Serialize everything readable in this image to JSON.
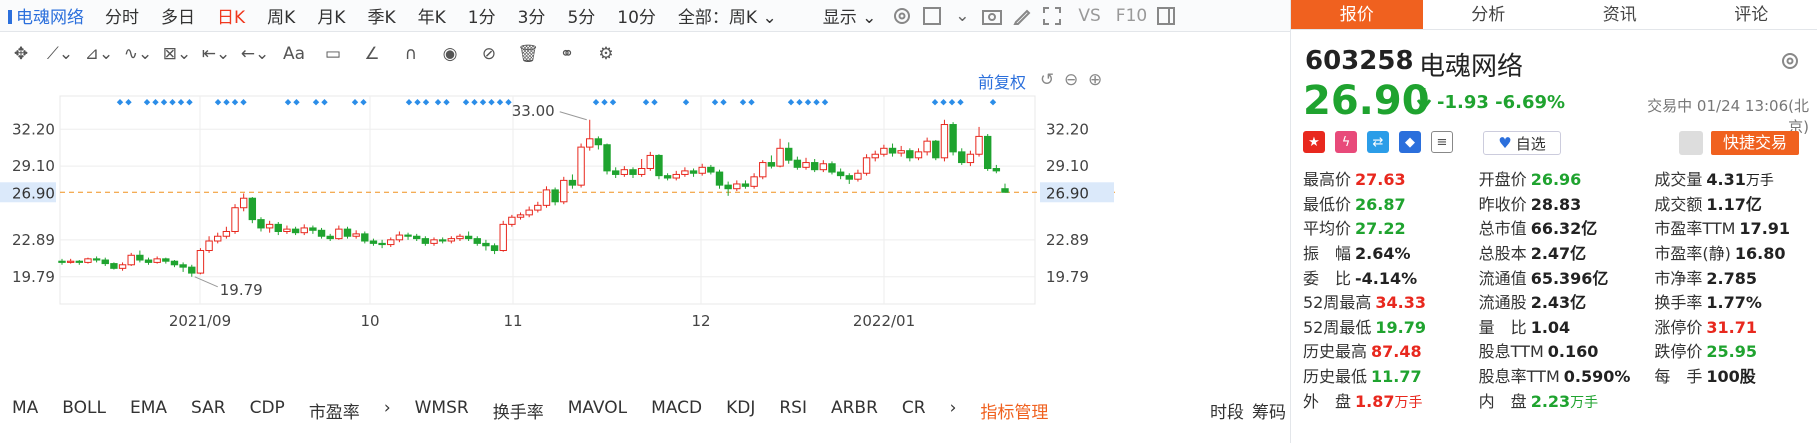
{
  "toolbar": {
    "stock_name": "电魂网络",
    "periods": [
      "分时",
      "多日",
      "日K",
      "周K",
      "月K",
      "季K",
      "年K",
      "1分",
      "3分",
      "5分",
      "10分"
    ],
    "active_period": "日K",
    "scope": "全部：周K",
    "display": "显示",
    "vs": "VS",
    "f10": "F10"
  },
  "adjust": "前复权",
  "chart_data": {
    "type": "candlestick",
    "title": "",
    "y_ticks": [
      32.2,
      29.1,
      26.9,
      22.89,
      19.79
    ],
    "ylim": [
      17.5,
      35.0
    ],
    "x_ticks": [
      "2021/09",
      "10",
      "11",
      "12",
      "2022/01"
    ],
    "last_price": 26.9,
    "annotations": [
      {
        "label": "33.00"
      },
      {
        "label": "19.79"
      }
    ],
    "candles": [
      {
        "o": 21.1,
        "c": 21.0,
        "h": 21.3,
        "l": 20.8
      },
      {
        "o": 21.0,
        "c": 21.1,
        "h": 21.3,
        "l": 20.9
      },
      {
        "o": 21.1,
        "c": 21.0,
        "h": 21.2,
        "l": 20.8
      },
      {
        "o": 21.0,
        "c": 21.3,
        "h": 21.4,
        "l": 20.9
      },
      {
        "o": 21.3,
        "c": 21.2,
        "h": 21.5,
        "l": 21.0
      },
      {
        "o": 21.2,
        "c": 20.9,
        "h": 21.4,
        "l": 20.7
      },
      {
        "o": 20.9,
        "c": 20.5,
        "h": 21.0,
        "l": 20.4
      },
      {
        "o": 20.5,
        "c": 20.8,
        "h": 21.0,
        "l": 20.3
      },
      {
        "o": 20.8,
        "c": 21.6,
        "h": 21.8,
        "l": 20.7
      },
      {
        "o": 21.6,
        "c": 21.2,
        "h": 22.0,
        "l": 21.0
      },
      {
        "o": 21.2,
        "c": 21.0,
        "h": 21.4,
        "l": 20.8
      },
      {
        "o": 21.0,
        "c": 21.3,
        "h": 21.5,
        "l": 20.9
      },
      {
        "o": 21.3,
        "c": 21.1,
        "h": 21.4,
        "l": 20.9
      },
      {
        "o": 21.1,
        "c": 20.8,
        "h": 21.2,
        "l": 20.6
      },
      {
        "o": 20.8,
        "c": 20.6,
        "h": 21.0,
        "l": 20.2
      },
      {
        "o": 20.6,
        "c": 20.1,
        "h": 20.8,
        "l": 19.79
      },
      {
        "o": 20.1,
        "c": 22.0,
        "h": 22.2,
        "l": 20.0
      },
      {
        "o": 22.0,
        "c": 22.8,
        "h": 23.2,
        "l": 21.8
      },
      {
        "o": 22.8,
        "c": 23.2,
        "h": 23.5,
        "l": 22.6
      },
      {
        "o": 23.2,
        "c": 23.6,
        "h": 24.0,
        "l": 23.0
      },
      {
        "o": 23.6,
        "c": 25.6,
        "h": 25.9,
        "l": 23.4
      },
      {
        "o": 25.6,
        "c": 26.4,
        "h": 26.8,
        "l": 25.3
      },
      {
        "o": 26.4,
        "c": 24.6,
        "h": 26.5,
        "l": 24.3
      },
      {
        "o": 24.6,
        "c": 23.9,
        "h": 24.8,
        "l": 23.6
      },
      {
        "o": 23.9,
        "c": 24.2,
        "h": 24.5,
        "l": 23.5
      },
      {
        "o": 24.2,
        "c": 23.6,
        "h": 24.4,
        "l": 23.3
      },
      {
        "o": 23.6,
        "c": 23.8,
        "h": 24.1,
        "l": 23.4
      },
      {
        "o": 23.8,
        "c": 23.5,
        "h": 24.0,
        "l": 23.3
      },
      {
        "o": 23.5,
        "c": 23.9,
        "h": 24.2,
        "l": 23.3
      },
      {
        "o": 23.9,
        "c": 23.7,
        "h": 24.1,
        "l": 23.4
      },
      {
        "o": 23.7,
        "c": 23.2,
        "h": 23.9,
        "l": 23.0
      },
      {
        "o": 23.2,
        "c": 23.0,
        "h": 23.4,
        "l": 22.8
      },
      {
        "o": 23.0,
        "c": 23.8,
        "h": 24.1,
        "l": 22.9
      },
      {
        "o": 23.8,
        "c": 23.2,
        "h": 24.0,
        "l": 23.0
      },
      {
        "o": 23.2,
        "c": 23.4,
        "h": 23.7,
        "l": 23.0
      },
      {
        "o": 23.4,
        "c": 22.8,
        "h": 23.6,
        "l": 22.6
      },
      {
        "o": 22.8,
        "c": 22.6,
        "h": 23.0,
        "l": 22.4
      },
      {
        "o": 22.6,
        "c": 22.5,
        "h": 22.9,
        "l": 22.2
      },
      {
        "o": 22.5,
        "c": 22.9,
        "h": 23.1,
        "l": 22.3
      },
      {
        "o": 22.9,
        "c": 23.3,
        "h": 23.6,
        "l": 22.7
      },
      {
        "o": 23.3,
        "c": 23.2,
        "h": 23.5,
        "l": 22.9
      },
      {
        "o": 23.2,
        "c": 23.0,
        "h": 23.4,
        "l": 22.8
      },
      {
        "o": 23.0,
        "c": 22.6,
        "h": 23.2,
        "l": 22.4
      },
      {
        "o": 22.6,
        "c": 22.9,
        "h": 23.1,
        "l": 22.4
      },
      {
        "o": 22.9,
        "c": 22.8,
        "h": 23.1,
        "l": 22.6
      },
      {
        "o": 22.8,
        "c": 23.0,
        "h": 23.2,
        "l": 22.6
      },
      {
        "o": 23.0,
        "c": 23.2,
        "h": 23.4,
        "l": 22.8
      },
      {
        "o": 23.2,
        "c": 23.0,
        "h": 23.6,
        "l": 22.8
      },
      {
        "o": 23.0,
        "c": 22.6,
        "h": 23.2,
        "l": 22.4
      },
      {
        "o": 22.6,
        "c": 22.4,
        "h": 22.9,
        "l": 22.0
      },
      {
        "o": 22.4,
        "c": 22.0,
        "h": 22.6,
        "l": 21.7
      },
      {
        "o": 22.0,
        "c": 24.2,
        "h": 24.5,
        "l": 21.9
      },
      {
        "o": 24.2,
        "c": 24.8,
        "h": 25.0,
        "l": 24.0
      },
      {
        "o": 24.8,
        "c": 25.0,
        "h": 25.2,
        "l": 24.6
      },
      {
        "o": 25.0,
        "c": 25.4,
        "h": 25.7,
        "l": 24.8
      },
      {
        "o": 25.4,
        "c": 25.8,
        "h": 26.1,
        "l": 25.2
      },
      {
        "o": 25.8,
        "c": 27.1,
        "h": 27.4,
        "l": 25.6
      },
      {
        "o": 27.1,
        "c": 26.1,
        "h": 27.3,
        "l": 25.8
      },
      {
        "o": 26.1,
        "c": 27.9,
        "h": 28.2,
        "l": 25.9
      },
      {
        "o": 27.9,
        "c": 27.5,
        "h": 28.4,
        "l": 27.2
      },
      {
        "o": 27.5,
        "c": 30.7,
        "h": 31.0,
        "l": 27.3
      },
      {
        "o": 30.7,
        "c": 31.4,
        "h": 33.0,
        "l": 30.4
      },
      {
        "o": 31.4,
        "c": 30.9,
        "h": 31.6,
        "l": 30.5
      },
      {
        "o": 30.9,
        "c": 28.7,
        "h": 31.0,
        "l": 28.4
      },
      {
        "o": 28.7,
        "c": 28.4,
        "h": 29.0,
        "l": 28.1
      },
      {
        "o": 28.4,
        "c": 28.8,
        "h": 29.1,
        "l": 28.2
      },
      {
        "o": 28.8,
        "c": 28.4,
        "h": 29.0,
        "l": 28.1
      },
      {
        "o": 28.4,
        "c": 28.9,
        "h": 29.7,
        "l": 28.2
      },
      {
        "o": 28.9,
        "c": 30.0,
        "h": 30.3,
        "l": 28.7
      },
      {
        "o": 30.0,
        "c": 28.3,
        "h": 30.1,
        "l": 28.0
      },
      {
        "o": 28.3,
        "c": 28.1,
        "h": 28.5,
        "l": 27.9
      },
      {
        "o": 28.1,
        "c": 28.4,
        "h": 28.7,
        "l": 27.9
      },
      {
        "o": 28.4,
        "c": 28.7,
        "h": 29.0,
        "l": 28.2
      },
      {
        "o": 28.7,
        "c": 28.5,
        "h": 28.9,
        "l": 28.2
      },
      {
        "o": 28.5,
        "c": 29.0,
        "h": 29.3,
        "l": 28.3
      },
      {
        "o": 29.0,
        "c": 28.6,
        "h": 29.2,
        "l": 28.4
      },
      {
        "o": 28.6,
        "c": 27.5,
        "h": 28.8,
        "l": 27.2
      },
      {
        "o": 27.5,
        "c": 27.2,
        "h": 27.8,
        "l": 26.6
      },
      {
        "o": 27.2,
        "c": 27.6,
        "h": 27.9,
        "l": 27.0
      },
      {
        "o": 27.6,
        "c": 27.4,
        "h": 27.9,
        "l": 27.2
      },
      {
        "o": 27.4,
        "c": 28.2,
        "h": 28.5,
        "l": 27.2
      },
      {
        "o": 28.2,
        "c": 29.4,
        "h": 29.6,
        "l": 28.0
      },
      {
        "o": 29.4,
        "c": 29.1,
        "h": 30.0,
        "l": 28.9
      },
      {
        "o": 29.1,
        "c": 30.6,
        "h": 31.4,
        "l": 29.0
      },
      {
        "o": 30.6,
        "c": 29.6,
        "h": 31.1,
        "l": 29.3
      },
      {
        "o": 29.6,
        "c": 29.0,
        "h": 29.9,
        "l": 28.8
      },
      {
        "o": 29.0,
        "c": 29.4,
        "h": 29.8,
        "l": 28.8
      },
      {
        "o": 29.4,
        "c": 28.8,
        "h": 29.7,
        "l": 28.6
      },
      {
        "o": 28.8,
        "c": 29.3,
        "h": 29.6,
        "l": 28.6
      },
      {
        "o": 29.3,
        "c": 28.6,
        "h": 29.5,
        "l": 28.4
      },
      {
        "o": 28.6,
        "c": 28.3,
        "h": 28.9,
        "l": 28.0
      },
      {
        "o": 28.3,
        "c": 28.0,
        "h": 28.5,
        "l": 27.6
      },
      {
        "o": 28.0,
        "c": 28.5,
        "h": 28.8,
        "l": 27.8
      },
      {
        "o": 28.5,
        "c": 29.8,
        "h": 30.1,
        "l": 28.3
      },
      {
        "o": 29.8,
        "c": 30.1,
        "h": 30.4,
        "l": 29.5
      },
      {
        "o": 30.1,
        "c": 30.6,
        "h": 30.9,
        "l": 29.9
      },
      {
        "o": 30.6,
        "c": 30.2,
        "h": 31.0,
        "l": 29.9
      },
      {
        "o": 30.2,
        "c": 30.4,
        "h": 30.8,
        "l": 29.9
      },
      {
        "o": 30.4,
        "c": 29.8,
        "h": 30.6,
        "l": 29.5
      },
      {
        "o": 29.8,
        "c": 30.3,
        "h": 30.6,
        "l": 29.6
      },
      {
        "o": 30.3,
        "c": 31.2,
        "h": 31.5,
        "l": 30.0
      },
      {
        "o": 31.2,
        "c": 29.8,
        "h": 31.3,
        "l": 29.6
      },
      {
        "o": 29.8,
        "c": 32.6,
        "h": 33.0,
        "l": 29.5
      },
      {
        "o": 32.6,
        "c": 30.3,
        "h": 32.8,
        "l": 30.0
      },
      {
        "o": 30.3,
        "c": 29.4,
        "h": 30.6,
        "l": 29.2
      },
      {
        "o": 29.4,
        "c": 30.1,
        "h": 30.4,
        "l": 29.1
      },
      {
        "o": 30.1,
        "c": 31.6,
        "h": 32.4,
        "l": 29.9
      },
      {
        "o": 31.6,
        "c": 28.9,
        "h": 31.8,
        "l": 28.7
      },
      {
        "o": 28.9,
        "c": 28.7,
        "h": 29.2,
        "l": 28.5
      },
      {
        "o": 27.2,
        "c": 26.9,
        "h": 27.63,
        "l": 26.87
      }
    ]
  },
  "quote": {
    "code": "603258",
    "name": "电魂网络",
    "price": "26.90",
    "change": "-1.93",
    "change_pct": "-6.69%",
    "status": "交易中 01/24 13:06(北京)",
    "fav": "自选",
    "quick_trade": "快捷交易"
  },
  "tabs": [
    "报价",
    "分析",
    "资讯",
    "评论"
  ],
  "stats": [
    [
      {
        "k": "最高价",
        "v": "27.63",
        "c": "red"
      },
      {
        "k": "开盘价",
        "v": "26.96",
        "c": "green"
      },
      {
        "k": "成交量",
        "v": "4.31",
        "u": "万手",
        "c": "dark"
      }
    ],
    [
      {
        "k": "最低价",
        "v": "26.87",
        "c": "green"
      },
      {
        "k": "昨收价",
        "v": "28.83",
        "c": "dark"
      },
      {
        "k": "成交额",
        "v": "1.17亿",
        "c": "dark"
      }
    ],
    [
      {
        "k": "平均价",
        "v": "27.22",
        "c": "green"
      },
      {
        "k": "总市值",
        "v": "66.32亿",
        "c": "dark"
      },
      {
        "k": "市盈率TTM",
        "v": "17.91",
        "c": "dark"
      }
    ],
    [
      {
        "k": "振　幅",
        "v": "2.64%",
        "c": "dark"
      },
      {
        "k": "总股本",
        "v": "2.47亿",
        "c": "dark"
      },
      {
        "k": "市盈率(静)",
        "v": "16.80",
        "c": "dark"
      }
    ],
    [
      {
        "k": "委　比",
        "v": "-4.14%",
        "c": "dark"
      },
      {
        "k": "流通值",
        "v": "65.396亿",
        "c": "dark"
      },
      {
        "k": "市净率",
        "v": "2.785",
        "c": "dark"
      }
    ],
    [
      {
        "k": "52周最高",
        "v": "34.33",
        "c": "red"
      },
      {
        "k": "流通股",
        "v": "2.43亿",
        "c": "dark"
      },
      {
        "k": "换手率",
        "v": "1.77%",
        "c": "dark"
      }
    ],
    [
      {
        "k": "52周最低",
        "v": "19.79",
        "c": "green"
      },
      {
        "k": "量　比",
        "v": "1.04",
        "c": "dark"
      },
      {
        "k": "涨停价",
        "v": "31.71",
        "c": "red"
      }
    ],
    [
      {
        "k": "历史最高",
        "v": "87.48",
        "c": "red"
      },
      {
        "k": "股息TTM",
        "v": "0.160",
        "c": "dark"
      },
      {
        "k": "跌停价",
        "v": "25.95",
        "c": "green"
      }
    ],
    [
      {
        "k": "历史最低",
        "v": "11.77",
        "c": "green"
      },
      {
        "k": "股息率TTM",
        "v": "0.590%",
        "c": "dark"
      },
      {
        "k": "每　手",
        "v": "100股",
        "c": "dark"
      }
    ],
    [
      {
        "k": "外　盘",
        "v": "1.87",
        "u": "万手",
        "c": "red"
      },
      {
        "k": "内　盘",
        "v": "2.23",
        "u": "万手",
        "c": "green"
      },
      {
        "k": "",
        "v": "",
        "c": "dark"
      }
    ]
  ],
  "indicators": [
    "MA",
    "BOLL",
    "EMA",
    "SAR",
    "CDP",
    "市盈率",
    "WMSR",
    "换手率",
    "MAVOL",
    "MACD",
    "KDJ",
    "RSI",
    "ARBR",
    "CR"
  ],
  "indicator_manage": "指标管理",
  "side_tabs": [
    "时段",
    "筹码"
  ]
}
